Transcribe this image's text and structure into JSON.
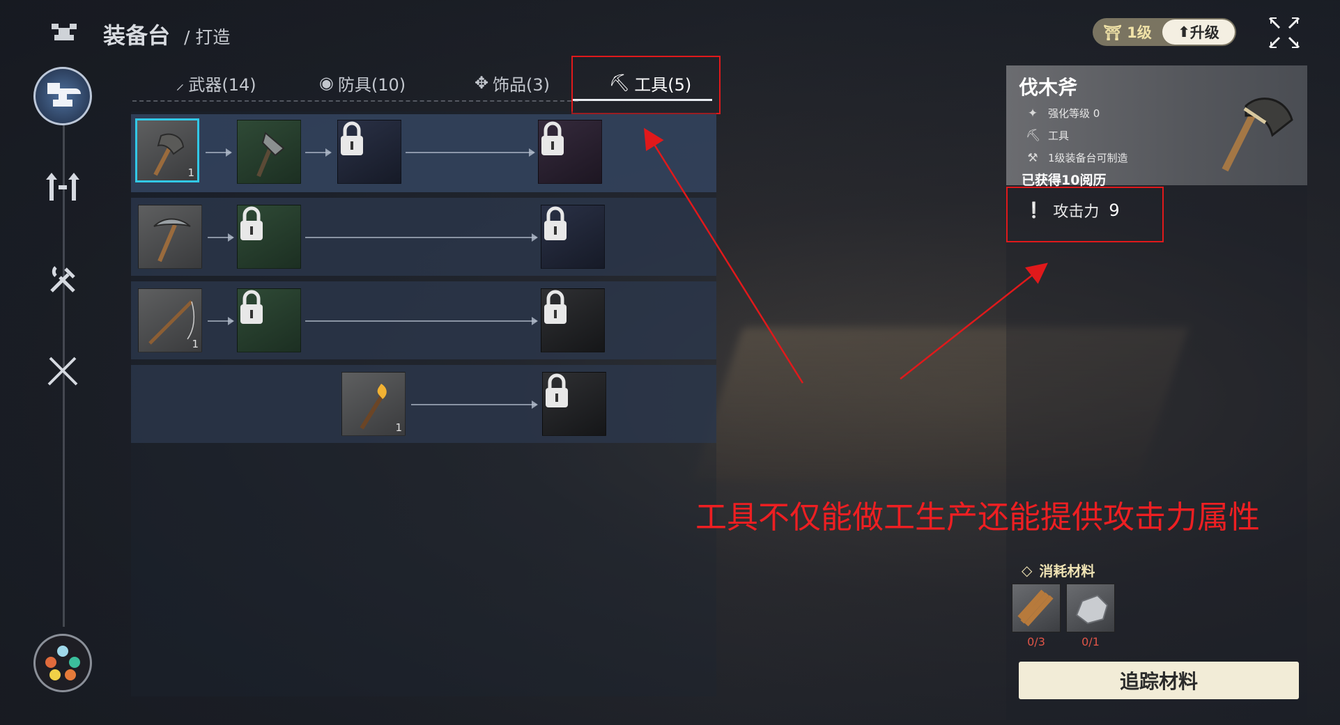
{
  "header": {
    "icon": "anvil-glyph-icon",
    "title": "装备台",
    "subtitle": "/ 打造"
  },
  "level": {
    "label": "1级",
    "upgrade_label": "升级"
  },
  "tabs": [
    {
      "icon": "sword-icon",
      "label": "武器(14)"
    },
    {
      "icon": "shield-icon",
      "label": "防具(10)"
    },
    {
      "icon": "gem-icon",
      "label": "饰品(3)"
    },
    {
      "icon": "pickaxe-icon",
      "label": "工具(5)"
    }
  ],
  "active_tab": 3,
  "grid": {
    "rows": [
      {
        "items": [
          {
            "state": "unlocked",
            "icon": "stone-axe-icon",
            "count": "1",
            "selected": true
          },
          {
            "state": "unlocked",
            "icon": "iron-axe-icon",
            "count": ""
          },
          {
            "state": "locked",
            "icon": "lock-icon"
          },
          {
            "state": "locked",
            "icon": "lock-icon"
          }
        ]
      },
      {
        "items": [
          {
            "state": "unlocked",
            "icon": "pickaxe-icon",
            "count": ""
          },
          {
            "state": "locked",
            "icon": "lock-icon"
          },
          {
            "state": "locked",
            "icon": "lock-icon"
          }
        ]
      },
      {
        "items": [
          {
            "state": "unlocked",
            "icon": "fishing-rod-icon",
            "count": "1"
          },
          {
            "state": "locked",
            "icon": "lock-icon"
          },
          {
            "state": "locked",
            "icon": "lock-icon"
          }
        ]
      },
      {
        "items": [
          {
            "state": "unlocked",
            "icon": "torch-icon",
            "count": "1"
          },
          {
            "state": "locked",
            "icon": "lock-icon"
          }
        ]
      }
    ]
  },
  "detail": {
    "name": "伐木斧",
    "attributes": [
      {
        "icon": "sparkle-icon",
        "text": "强化等级 0"
      },
      {
        "icon": "pickaxe-icon",
        "text": "工具"
      },
      {
        "icon": "anvil-icon",
        "text": "1级装备台可制造"
      }
    ],
    "xp": "已获得10阅历",
    "attack_label": "攻击力",
    "attack_value": "9"
  },
  "annotation": "工具不仅能做工生产还能提供攻击力属性",
  "materials": {
    "title": "消耗材料",
    "items": [
      {
        "icon": "wood-icon",
        "count": "0/3"
      },
      {
        "icon": "stone-icon",
        "count": "0/1"
      }
    ],
    "track_label": "追踪材料"
  },
  "colors": {
    "accent_red": "#e0191b",
    "selected": "#32c8e6",
    "gold": "#efe3b4"
  }
}
